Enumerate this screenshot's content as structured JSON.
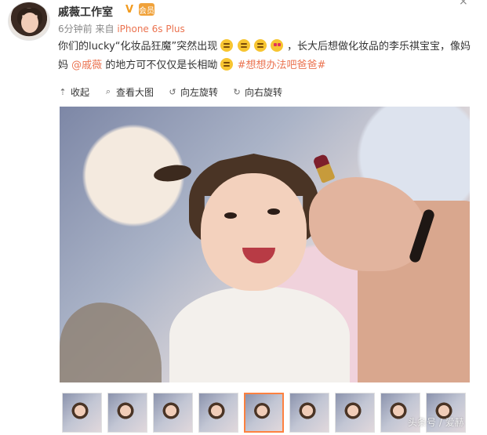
{
  "post": {
    "username": "戚薇工作室",
    "verified_icon": "V",
    "member_badge": "会员",
    "close_icon": "×",
    "time": "6分钟前",
    "source_prefix": "来自",
    "source": "iPhone 6s Plus",
    "text": {
      "part1": "你们的lucky“化妆品狂魔”突然出现",
      "part2": "，长大后想做化妆品的李乐祺宝宝，像妈妈",
      "mention": "@戚薇",
      "part3": " 的地方可不仅仅是长相呦",
      "hashtag": "#想想办法吧爸爸#"
    }
  },
  "toolbar": {
    "collapse": "收起",
    "view_large": "查看大图",
    "rotate_left": "向左旋转",
    "rotate_right": "向右旋转"
  },
  "thumbnails": [
    "1",
    "2",
    "3",
    "4",
    "5",
    "6",
    "7",
    "8",
    "9"
  ],
  "watermark": "头条号 / 爱赫",
  "colors": {
    "link": "#eb7350",
    "active_thumb_border": "#ff8140",
    "verified": "#f29b1f"
  }
}
